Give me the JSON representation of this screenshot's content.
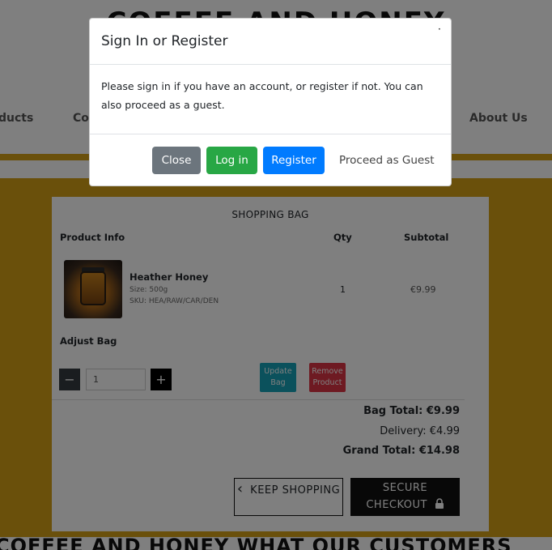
{
  "site": {
    "title": "COFFEE AND HONEY",
    "bottom_title": "COFFEE AND HONEY WHAT OUR CUSTOMERS"
  },
  "nav": {
    "items": [
      {
        "label": "ducts"
      },
      {
        "label": "Co"
      },
      {
        "label": "About Us"
      }
    ]
  },
  "bag": {
    "heading": "SHOPPING BAG",
    "columns": {
      "product": "Product Info",
      "qty": "Qty",
      "subtotal": "Subtotal"
    },
    "item": {
      "name": "Heather Honey",
      "size": "Size: 500g",
      "sku": "SKU: HEA/RAW/CAR/DEN",
      "qty": "1",
      "subtotal": "€9.99"
    },
    "adjust_label": "Adjust Bag",
    "minus_label": "−",
    "plus_label": "+",
    "qty_value": "1",
    "update_label": "Update Bag",
    "remove_label": "Remove Product",
    "bag_total": "Bag Total: €9.99",
    "delivery": "Delivery: €4.99",
    "grand_total": "Grand Total: €14.98",
    "keep_shopping": "KEEP SHOPPING",
    "keep_icon": "‹",
    "checkout": "SECURE CHECKOUT",
    "lock_icon": "lock-icon"
  },
  "modal": {
    "title": "Sign In or Register",
    "close_glyph": "·",
    "body": "Please sign in if you have an account, or register if not. You can also proceed as a guest.",
    "buttons": {
      "close": "Close",
      "login": "Log in",
      "register": "Register",
      "guest": "Proceed as Guest"
    }
  },
  "colors": {
    "gold": "#d4a017",
    "close_btn": "#6c757d",
    "login_btn": "#28a745",
    "register_btn": "#007bff",
    "update_btn": "#17a2b8",
    "remove_btn": "#dc3545"
  }
}
